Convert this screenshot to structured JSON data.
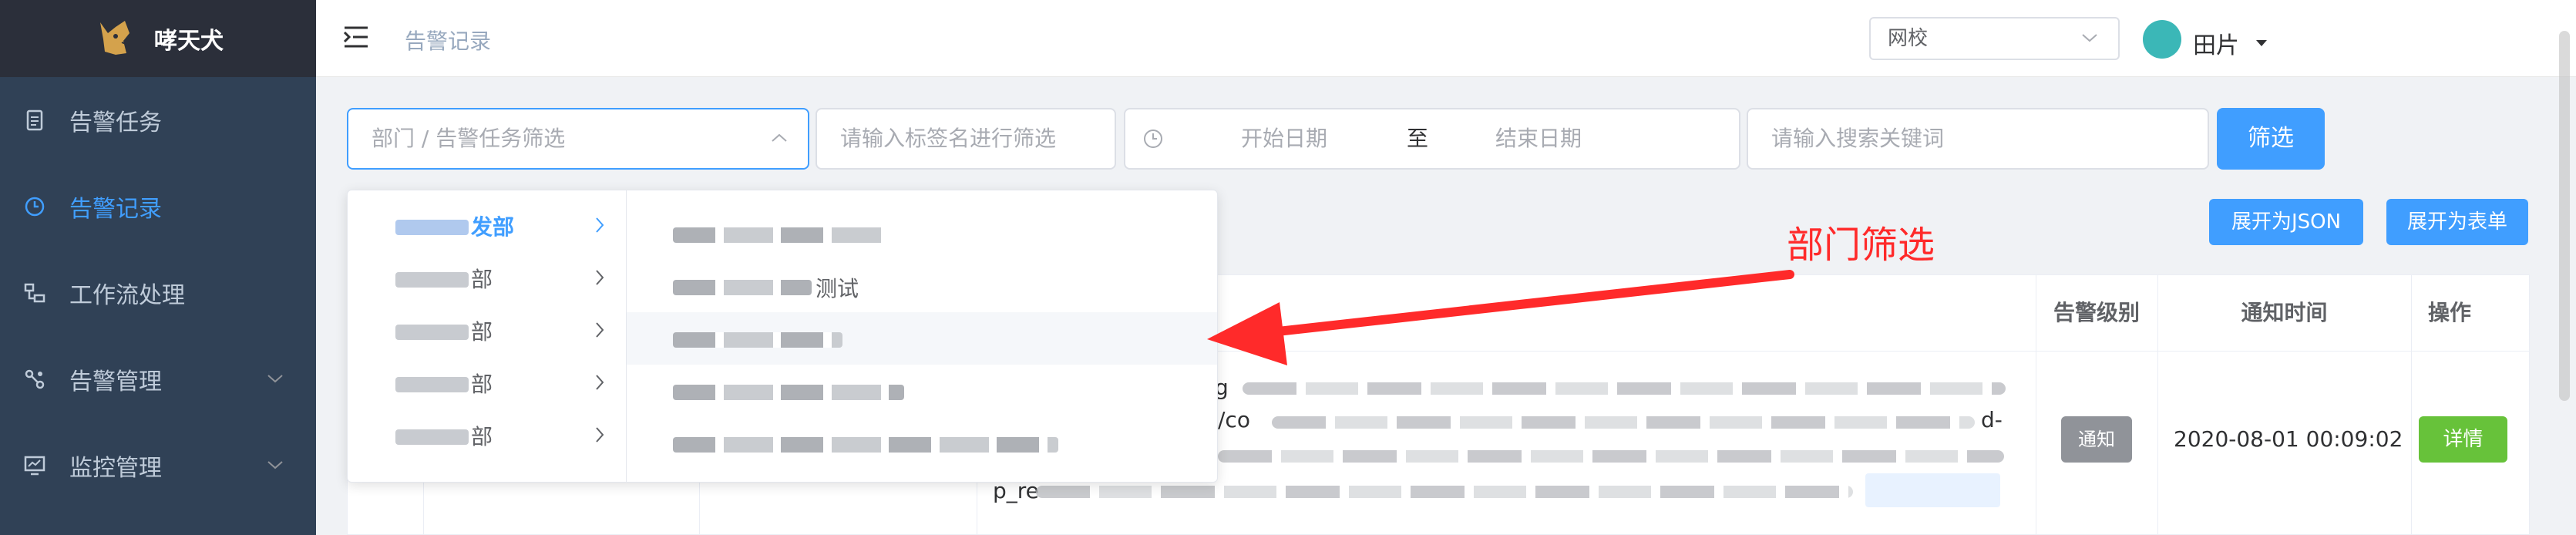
{
  "app": {
    "name": "哮天犬"
  },
  "sidebar": {
    "items": [
      {
        "label": "告警任务",
        "icon": "clipboard-icon",
        "active": false,
        "expandable": false
      },
      {
        "label": "告警记录",
        "icon": "clock-icon",
        "active": true,
        "expandable": false
      },
      {
        "label": "工作流处理",
        "icon": "workflow-icon",
        "active": false,
        "expandable": false
      },
      {
        "label": "告警管理",
        "icon": "nodes-icon",
        "active": false,
        "expandable": true
      },
      {
        "label": "监控管理",
        "icon": "monitor-chart-icon",
        "active": false,
        "expandable": true
      }
    ]
  },
  "header": {
    "breadcrumb": "告警记录",
    "school_select": "网校",
    "user_name": "田片"
  },
  "filters": {
    "cascader_placeholder": "部门 / 告警任务筛选",
    "tag_placeholder": "请输入标签名进行筛选",
    "date_start": "开始日期",
    "date_sep": "至",
    "date_end": "结束日期",
    "keyword_placeholder": "请输入搜索关键词",
    "submit_label": "筛选"
  },
  "actions": {
    "expand_json": "展开为JSON",
    "expand_table": "展开为表单"
  },
  "cascader": {
    "departments": [
      {
        "label": "发部",
        "active": true
      },
      {
        "label": "部",
        "active": false
      },
      {
        "label": "部",
        "active": false
      },
      {
        "label": "部",
        "active": false
      },
      {
        "label": "部",
        "active": false
      }
    ],
    "options": [
      {
        "label": ""
      },
      {
        "label": "测试"
      },
      {
        "label": ""
      },
      {
        "label": ""
      },
      {
        "label": ""
      }
    ]
  },
  "table": {
    "columns": {
      "level": "告警级别",
      "time": "通知时间",
      "action": "操作"
    },
    "rows": [
      {
        "level": "通知",
        "time": "2020-08-01 00:09:02",
        "action": "详情",
        "content_fragments": [
          "g",
          "/co",
          "d-",
          "p_re"
        ]
      }
    ]
  },
  "annotation": {
    "text": "部门筛选",
    "color": "#ff2a2a"
  },
  "colors": {
    "sidebar": "#304156",
    "accent": "#409eff",
    "success": "#67c23a",
    "info": "#909399"
  }
}
